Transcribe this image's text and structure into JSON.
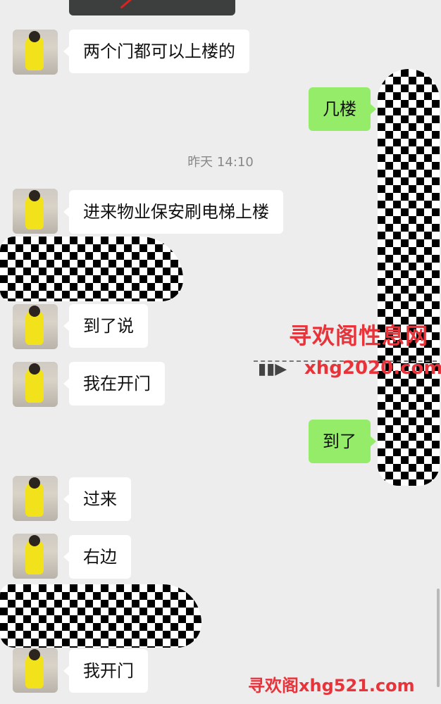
{
  "messages": [
    {
      "side": "left",
      "text": "两个门都可以上楼的"
    },
    {
      "side": "right",
      "text": "几楼"
    },
    {
      "side": "left",
      "text": "进来物业保安刷电梯上楼"
    },
    {
      "side": "left",
      "text": "到了说"
    },
    {
      "side": "left",
      "text": "我在开门"
    },
    {
      "side": "right",
      "text": "到了"
    },
    {
      "side": "left",
      "text": "过来"
    },
    {
      "side": "left",
      "text": "右边"
    },
    {
      "side": "left",
      "text": "我开门"
    }
  ],
  "timestamp": "昨天 14:10",
  "watermark": {
    "line1": "寻欢阁性息网",
    "line2": "xhg2020.com",
    "bottom": "寻欢阁xhg521.com"
  },
  "colors": {
    "background": "#ededed",
    "incoming_bubble": "#ffffff",
    "outgoing_bubble": "#95ec69",
    "watermark": "#e8333a"
  }
}
